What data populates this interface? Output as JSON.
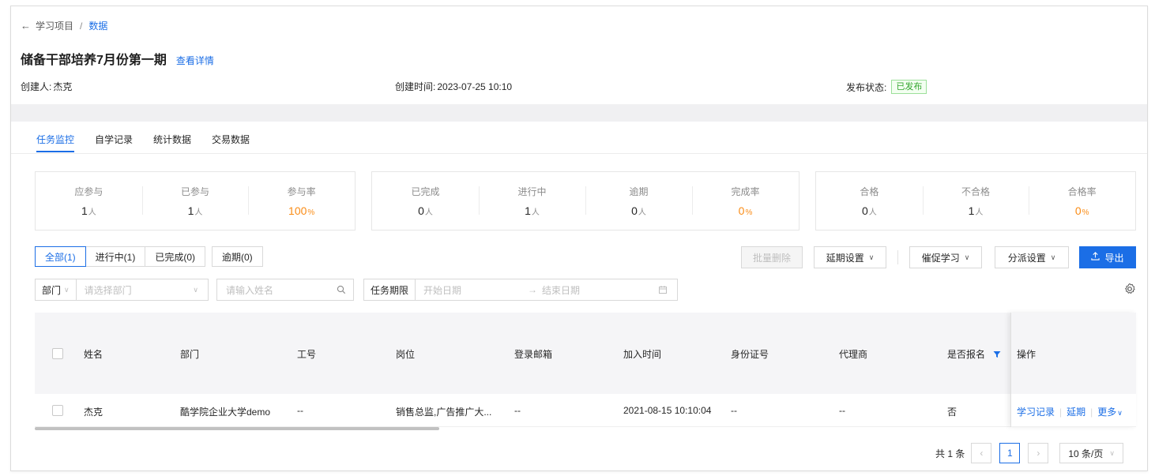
{
  "breadcrumb": {
    "back_icon": "arrow-left-icon",
    "parent": "学习项目",
    "separator": "/",
    "current": "数据"
  },
  "header": {
    "title": "储备干部培养7月份第一期",
    "detail_link": "查看详情"
  },
  "meta": {
    "creator_label": "创建人:",
    "creator": "杰克",
    "created_label": "创建时间:",
    "created_time": "2023-07-25 10:10",
    "status_label": "发布状态:",
    "status": "已发布"
  },
  "tabs": [
    "任务监控",
    "自学记录",
    "统计数据",
    "交易数据"
  ],
  "stats": {
    "group1": [
      {
        "label": "应参与",
        "value": "1",
        "unit": "人"
      },
      {
        "label": "已参与",
        "value": "1",
        "unit": "人"
      },
      {
        "label": "参与率",
        "value": "100",
        "unit": "%"
      }
    ],
    "group2": [
      {
        "label": "已完成",
        "value": "0",
        "unit": "人"
      },
      {
        "label": "进行中",
        "value": "1",
        "unit": "人"
      },
      {
        "label": "逾期",
        "value": "0",
        "unit": "人"
      },
      {
        "label": "完成率",
        "value": "0",
        "unit": "%"
      }
    ],
    "group3": [
      {
        "label": "合格",
        "value": "0",
        "unit": "人"
      },
      {
        "label": "不合格",
        "value": "1",
        "unit": "人"
      },
      {
        "label": "合格率",
        "value": "0",
        "unit": "%"
      }
    ]
  },
  "filters": {
    "all": "全部(1)",
    "in_progress": "进行中(1)",
    "done": "已完成(0)",
    "overdue": "逾期(0)"
  },
  "actions": {
    "batch_delete": "批量删除",
    "extend": "延期设置",
    "remind": "催促学习",
    "assign": "分派设置",
    "export": "导出"
  },
  "search": {
    "dept_label": "部门",
    "dept_placeholder": "请选择部门",
    "name_placeholder": "请输入姓名",
    "period_label": "任务期限",
    "start_placeholder": "开始日期",
    "arrow": "→",
    "end_placeholder": "结束日期"
  },
  "table": {
    "headers": {
      "name": "姓名",
      "dept": "部门",
      "emp_no": "工号",
      "position": "岗位",
      "email": "登录邮箱",
      "joined": "加入时间",
      "id_no": "身份证号",
      "agent": "代理商",
      "enrolled": "是否报名",
      "ops": "操作"
    },
    "row": {
      "name": "杰克",
      "dept": "酷学院企业大学demo",
      "emp_no": "--",
      "position": "销售总监,广告推广大...",
      "email": "--",
      "joined": "2021-08-15 10:10:04",
      "id_no": "--",
      "agent": "--",
      "enrolled": "否",
      "op_record": "学习记录",
      "op_extend": "延期",
      "op_more": "更多"
    }
  },
  "pagination": {
    "total": "共 1 条",
    "page": "1",
    "size": "10 条/页"
  },
  "colors": {
    "accent": "#1b6ee6",
    "orange": "#fa8c16",
    "success": "#34a52f"
  }
}
